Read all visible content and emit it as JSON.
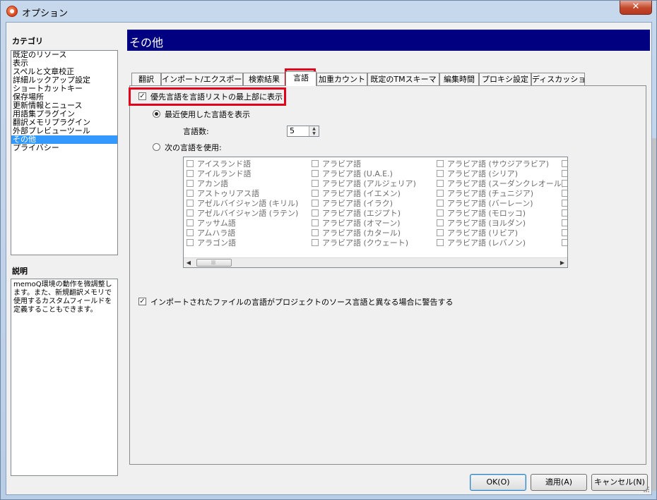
{
  "window": {
    "title": "オプション",
    "close_label": "✕"
  },
  "sidebar": {
    "category_label": "カテゴリ",
    "items": [
      {
        "label": "既定のリソース"
      },
      {
        "label": "表示"
      },
      {
        "label": "スペルと文章校正"
      },
      {
        "label": "詳細ルックアップ設定"
      },
      {
        "label": "ショートカットキー"
      },
      {
        "label": "保存場所"
      },
      {
        "label": "更新情報とニュース"
      },
      {
        "label": "用語集プラグイン"
      },
      {
        "label": "翻訳メモリプラグイン"
      },
      {
        "label": "外部プレビューツール"
      },
      {
        "label": "その他",
        "selected": true
      },
      {
        "label": "プライバシー"
      }
    ],
    "description_label": "説明",
    "description_text": "memoQ環境の動作を微調整します。また、新規翻訳メモリで使用するカスタムフィールドを定義することもできます。"
  },
  "page": {
    "title": "その他"
  },
  "tabs": [
    {
      "label": "翻訳"
    },
    {
      "label": "インポート/エクスポート"
    },
    {
      "label": "検索結果"
    },
    {
      "label": "言語",
      "active": true
    },
    {
      "label": "加重カウント"
    },
    {
      "label": "既定のTMスキーマ"
    },
    {
      "label": "編集時間"
    },
    {
      "label": "プロキシ設定"
    },
    {
      "label": "ディスカッション"
    }
  ],
  "language_tab": {
    "preferred_on_top_label": "優先言語を言語リストの最上部に表示",
    "preferred_on_top_checked": true,
    "recent_radio_label": "最近使用した言語を表示",
    "recent_radio_selected": true,
    "count_label": "言語数:",
    "count_value": "5",
    "specific_radio_label": "次の言語を使用:",
    "specific_radio_selected": false,
    "languages_col1": [
      "アイスランド語",
      "アイルランド語",
      "アカン語",
      "アストゥリアス語",
      "アゼルバイジャン語 (キリル)",
      "アゼルバイジャン語 (ラテン)",
      "アッサム語",
      "アムハラ語",
      "アラゴン語"
    ],
    "languages_col2": [
      "アラビア語",
      "アラビア語 (U.A.E.)",
      "アラビア語 (アルジェリア)",
      "アラビア語 (イエメン)",
      "アラビア語 (イラク)",
      "アラビア語 (エジプト)",
      "アラビア語 (オマーン)",
      "アラビア語 (カタール)",
      "アラビア語 (クウェート)"
    ],
    "languages_col3": [
      "アラビア語 (サウジアラビア)",
      "アラビア語 (シリア)",
      "アラビア語 (スーダンクレオール)",
      "アラビア語 (チュニジア)",
      "アラビア語 (バーレーン)",
      "アラビア語 (モロッコ)",
      "アラビア語 (ヨルダン)",
      "アラビア語 (リビア)",
      "アラビア語 (レバノン)"
    ],
    "warn_label": "インポートされたファイルの言語がプロジェクトのソース言語と異なる場合に警告する",
    "warn_checked": true
  },
  "buttons": {
    "ok": "OK(O)",
    "apply": "適用(A)",
    "cancel": "キャンセル(N)"
  },
  "colors": {
    "header_band": "#000080",
    "highlight_frame": "#e3001b",
    "selection": "#3399ff"
  }
}
